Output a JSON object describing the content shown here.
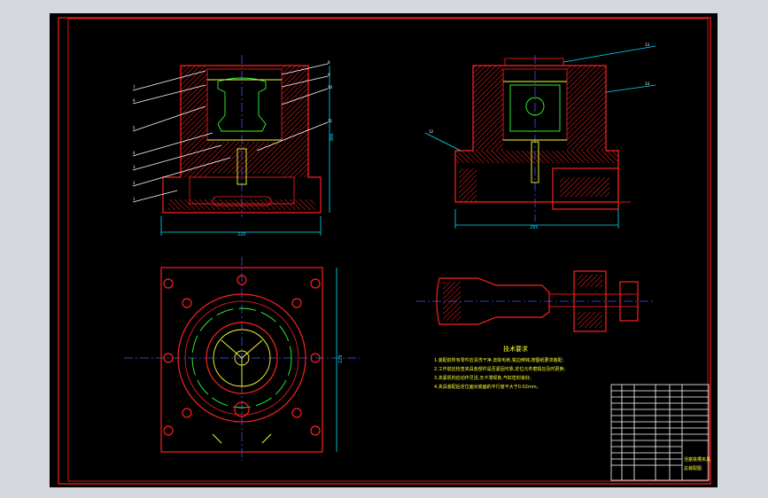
{
  "drawing": {
    "part_labels_left": [
      "7",
      "6",
      "5",
      "4",
      "3",
      "2",
      "1"
    ],
    "part_labels_right_of_left_view": [
      "8",
      "9",
      "10",
      "11"
    ],
    "part_labels_right_view": [
      "13",
      "14",
      "12"
    ],
    "dimension_left_width": "220",
    "dimension_left_height": "386",
    "dimension_right_width": "295",
    "dimension_plan_height": "228",
    "tech_req_title": "技术要求",
    "tech_req_lines": [
      "1.装配前所有零件应清洗干净,去除毛刺,锐边倒钝,按图纸要求装配;",
      "2.工作前应检查夹具各部件是否紧固可靠,定位元件磨损应及时更换;",
      "3.夹紧机构应动作灵活,无卡滞现象,气缸密封良好;",
      "4.夹具装配后定位面对底面的平行度不大于0.02mm。"
    ],
    "title_block_name": "活塞铣槽夹具",
    "title_block_sub": "总装配图"
  },
  "colors": {
    "background": "#000000",
    "frame": "#ff2020",
    "hatch": "#ff2020",
    "center": "#3a58ff",
    "dimension": "#00e0ff",
    "text": "#ffff30",
    "part": "#30ff30",
    "window_chrome": "#d4d8de"
  }
}
